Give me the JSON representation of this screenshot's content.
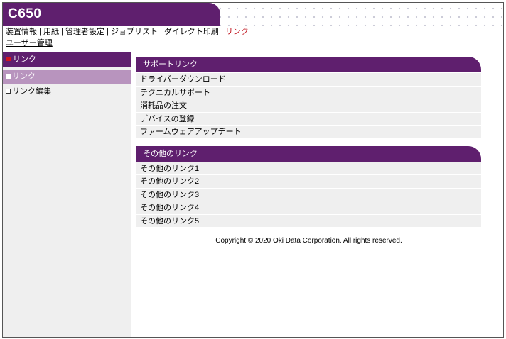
{
  "app": {
    "title": "C650"
  },
  "topnav": {
    "items": [
      "装置情報",
      "用紙",
      "管理者設定",
      "ジョブリスト",
      "ダイレクト印刷",
      "リンク"
    ],
    "second_row": "ユーザー管理",
    "active_color": "#c0141e"
  },
  "sidebar": {
    "header": "リンク",
    "items": [
      {
        "label": "リンク",
        "selected": true
      },
      {
        "label": "リンク編集",
        "selected": false
      }
    ]
  },
  "sections": [
    {
      "title": "サポートリンク",
      "links": [
        "ドライバーダウンロード",
        "テクニカルサポート",
        "消耗品の注文",
        "デバイスの登録",
        "ファームウェアアップデート"
      ]
    },
    {
      "title": "その他のリンク",
      "links": [
        "その他のリンク1",
        "その他のリンク2",
        "その他のリンク3",
        "その他のリンク4",
        "その他のリンク5"
      ]
    }
  ],
  "footer": {
    "copyright": "Copyright © 2020 Oki Data Corporation. All rights reserved."
  },
  "colors": {
    "brand": "#5f1f6e",
    "sidebar_selected": "#b894be",
    "row_bg": "#efefef"
  }
}
